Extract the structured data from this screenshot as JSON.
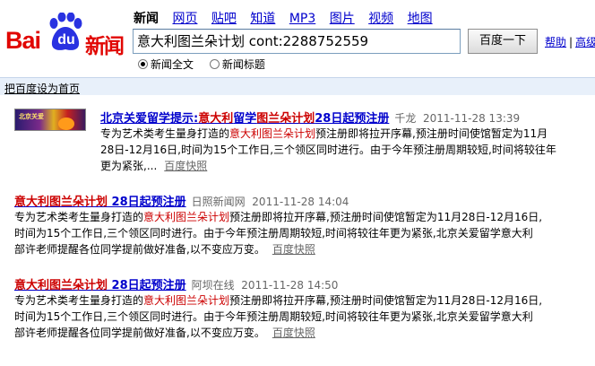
{
  "logo": {
    "bai": "Bai",
    "du": "du",
    "news": "新闻"
  },
  "nav": [
    "新闻",
    "网页",
    "贴吧",
    "知道",
    "MP3",
    "图片",
    "视频",
    "地图"
  ],
  "search": {
    "query": "意大利图兰朵计划 cont:2288752559",
    "button": "百度一下"
  },
  "links": {
    "help": "帮助",
    "advanced": "高级"
  },
  "options": {
    "full": "新闻全文",
    "title_only": "新闻标题"
  },
  "set_home": "把百度设为首页",
  "thumb_text": "北京关爱",
  "results": [
    {
      "title_pre": "北京关爱留学提示:",
      "title_hl": "意大利",
      "title_mid": "留学",
      "title_hl2": "图兰朵计划",
      "title_post": "28日起预注册",
      "source": "千龙",
      "time": "2011-11-28 13:39",
      "line1_a": "专为艺术类考生量身打造的",
      "line1_hl": "意大利图兰朵计划",
      "line1_b": "预注册即将拉开序幕,预注册时间使馆暂定为11月",
      "line2": "28日-12月16日,时间为15个工作日,三个领区同时进行。由于今年预注册周期较短,时间将较往年",
      "line3": "更为紧张,...",
      "snapshot": "百度快照"
    },
    {
      "title_hl": "意大利图兰朵计划",
      "title_post": " 28日起预注册",
      "source": "日照新闻网",
      "time": "2011-11-28 14:04",
      "line1_a": "专为艺术类考生量身打造的",
      "line1_hl": "意大利图兰朵计划",
      "line1_b": "预注册即将拉开序幕,预注册时间使馆暂定为11月28日-12月16日,",
      "line2": "时间为15个工作日,三个领区同时进行。由于今年预注册周期较短,时间将较往年更为紧张,北京关爱留学意大利",
      "line3": "部许老师提醒各位同学提前做好准备,以不变应万变。",
      "snapshot": "百度快照"
    },
    {
      "title_hl": "意大利图兰朵计划",
      "title_post": " 28日起预注册",
      "source": "阿坝在线",
      "time": "2011-11-28 14:50",
      "line1_a": "专为艺术类考生量身打造的",
      "line1_hl": "意大利图兰朵计划",
      "line1_b": "预注册即将拉开序幕,预注册时间使馆暂定为11月28日-12月16日,",
      "line2": "时间为15个工作日,三个领区同时进行。由于今年预注册周期较短,时间将较往年更为紧张,北京关爱留学意大利",
      "line3": "部许老师提醒各位同学提前做好准备,以不变应万变。",
      "snapshot": "百度快照"
    }
  ]
}
